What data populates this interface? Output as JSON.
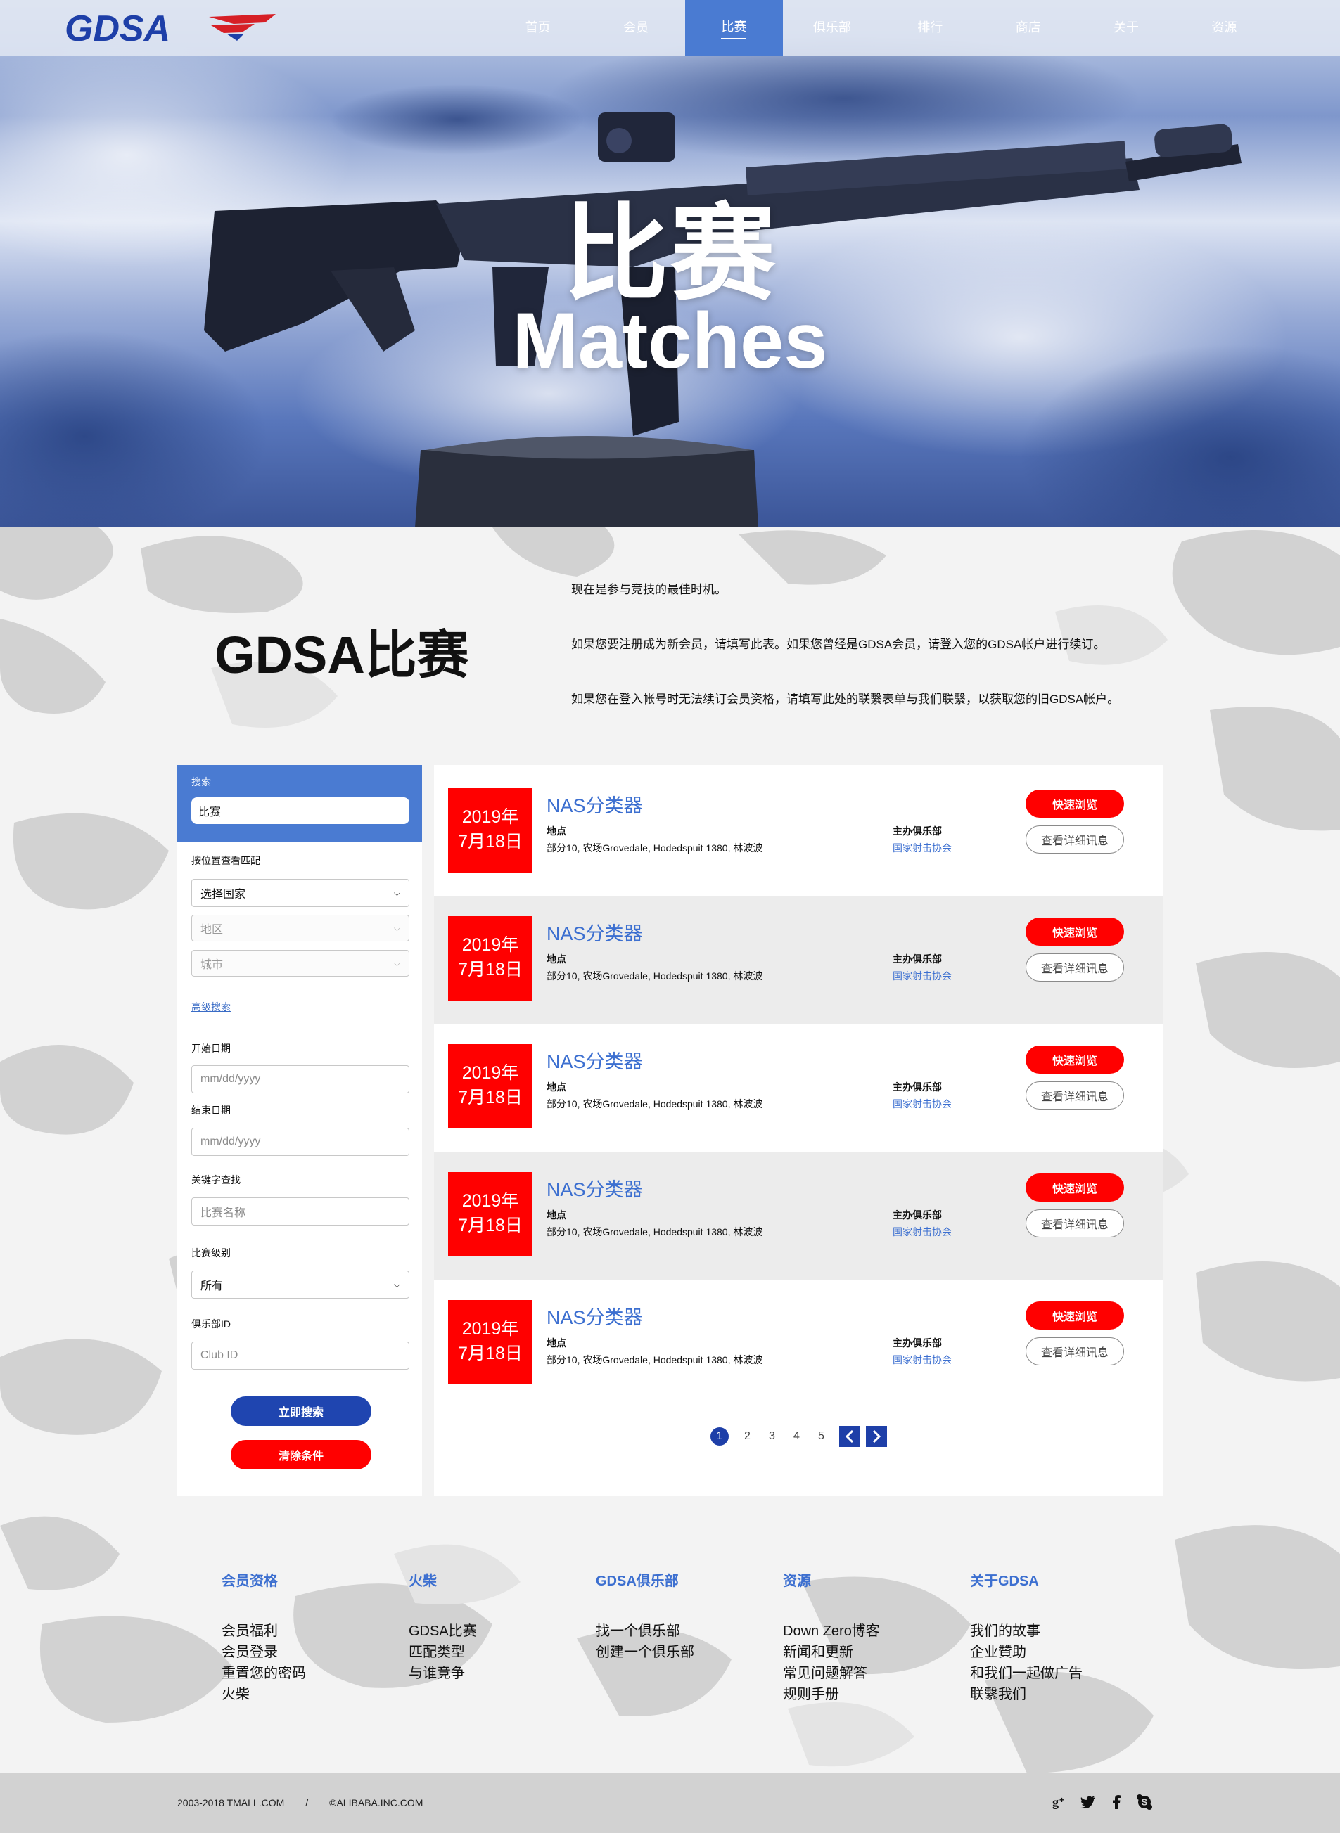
{
  "header": {
    "logo_text": "GDSA",
    "nav": [
      {
        "label": "首页",
        "active": false
      },
      {
        "label": "会员",
        "active": false
      },
      {
        "label": "比赛",
        "active": true
      },
      {
        "label": "俱乐部",
        "active": false
      },
      {
        "label": "排行",
        "active": false
      },
      {
        "label": "商店",
        "active": false
      },
      {
        "label": "关于",
        "active": false
      },
      {
        "label": "资源",
        "active": false
      }
    ]
  },
  "hero": {
    "title_cn": "比赛",
    "title_en": "Matches"
  },
  "intro": {
    "title": "GDSA比赛",
    "paragraphs": [
      "现在是参与竞技的最佳时机。",
      "如果您要注册成为新会员，请填写此表。如果您曾经是GDSA会员，请登入您的GDSA帐户进行续订。",
      "如果您在登入帐号时无法续订会员资格，请填写此处的联繫表单与我们联繫，以获取您的旧GDSA帐户。"
    ]
  },
  "sidebar": {
    "search_label": "搜索",
    "search_value": "比赛",
    "location_label": "按位置查看匹配",
    "country_select": "选择国家",
    "region_select": "地区",
    "city_select": "城市",
    "advanced_link": "高级搜索",
    "start_date_label": "开始日期",
    "start_date_placeholder": "mm/dd/yyyy",
    "end_date_label": "结束日期",
    "end_date_placeholder": "mm/dd/yyyy",
    "keyword_label": "关键字查找",
    "keyword_placeholder": "比赛名称",
    "level_label": "比赛级别",
    "level_select": "所有",
    "club_label": "俱乐部ID",
    "club_placeholder": "Club ID",
    "search_button": "立即搜索",
    "clear_button": "清除条件",
    "colors": {
      "search_button": "#1f45b0",
      "clear_button": "#ff0000"
    }
  },
  "matches": [
    {
      "date_year": "2019年",
      "date_day": "7月18日",
      "title": "NAS分类器",
      "location_label": "地点",
      "location": "部分10, 农场Grovedale, Hodedspuit 1380, 林波波",
      "club_label": "主办俱乐部",
      "club": "国家射击协会",
      "quick_button": "快速浏览",
      "detail_button": "查看详细讯息"
    },
    {
      "date_year": "2019年",
      "date_day": "7月18日",
      "title": "NAS分类器",
      "location_label": "地点",
      "location": "部分10, 农场Grovedale, Hodedspuit 1380, 林波波",
      "club_label": "主办俱乐部",
      "club": "国家射击协会",
      "quick_button": "快速浏览",
      "detail_button": "查看详细讯息"
    },
    {
      "date_year": "2019年",
      "date_day": "7月18日",
      "title": "NAS分类器",
      "location_label": "地点",
      "location": "部分10, 农场Grovedale, Hodedspuit 1380, 林波波",
      "club_label": "主办俱乐部",
      "club": "国家射击协会",
      "quick_button": "快速浏览",
      "detail_button": "查看详细讯息"
    },
    {
      "date_year": "2019年",
      "date_day": "7月18日",
      "title": "NAS分类器",
      "location_label": "地点",
      "location": "部分10, 农场Grovedale, Hodedspuit 1380, 林波波",
      "club_label": "主办俱乐部",
      "club": "国家射击协会",
      "quick_button": "快速浏览",
      "detail_button": "查看详细讯息"
    },
    {
      "date_year": "2019年",
      "date_day": "7月18日",
      "title": "NAS分类器",
      "location_label": "地点",
      "location": "部分10, 农场Grovedale, Hodedspuit 1380, 林波波",
      "club_label": "主办俱乐部",
      "club": "国家射击协会",
      "quick_button": "快速浏览",
      "detail_button": "查看详细讯息"
    }
  ],
  "pagination": {
    "current": "1",
    "pages": [
      "2",
      "3",
      "4",
      "5"
    ],
    "prev_icon": "chevron-left-icon",
    "next_icon": "chevron-right-icon"
  },
  "footer": {
    "columns": [
      {
        "heading": "会员资格",
        "links": [
          "会员福利",
          "会员登录",
          "重置您的密码",
          "火柴"
        ]
      },
      {
        "heading": "火柴",
        "links": [
          "GDSA比赛",
          "匹配类型",
          "与谁竞争"
        ]
      },
      {
        "heading": "GDSA俱乐部",
        "links": [
          "找一个俱乐部",
          "创建一个俱乐部"
        ]
      },
      {
        "heading": "资源",
        "links": [
          "Down Zero博客",
          "新闻和更新",
          "常见问题解答",
          "规则手册"
        ]
      },
      {
        "heading": "关于GDSA",
        "links": [
          "我们的故事",
          "企业贊助",
          "和我们一起做广告",
          "联繫我们"
        ]
      }
    ],
    "copyright_1": "2003-2018 TMALL.COM",
    "separator": "/",
    "copyright_2": "©ALIBABA.INC.COM",
    "social_icons": [
      "google-plus-icon",
      "twitter-icon",
      "facebook-icon",
      "skype-icon"
    ]
  },
  "colors": {
    "accent_blue": "#4a7bd2",
    "link_blue": "#3c6fd0",
    "date_red": "#ff0000",
    "pager_blue": "#1e3fa8"
  }
}
